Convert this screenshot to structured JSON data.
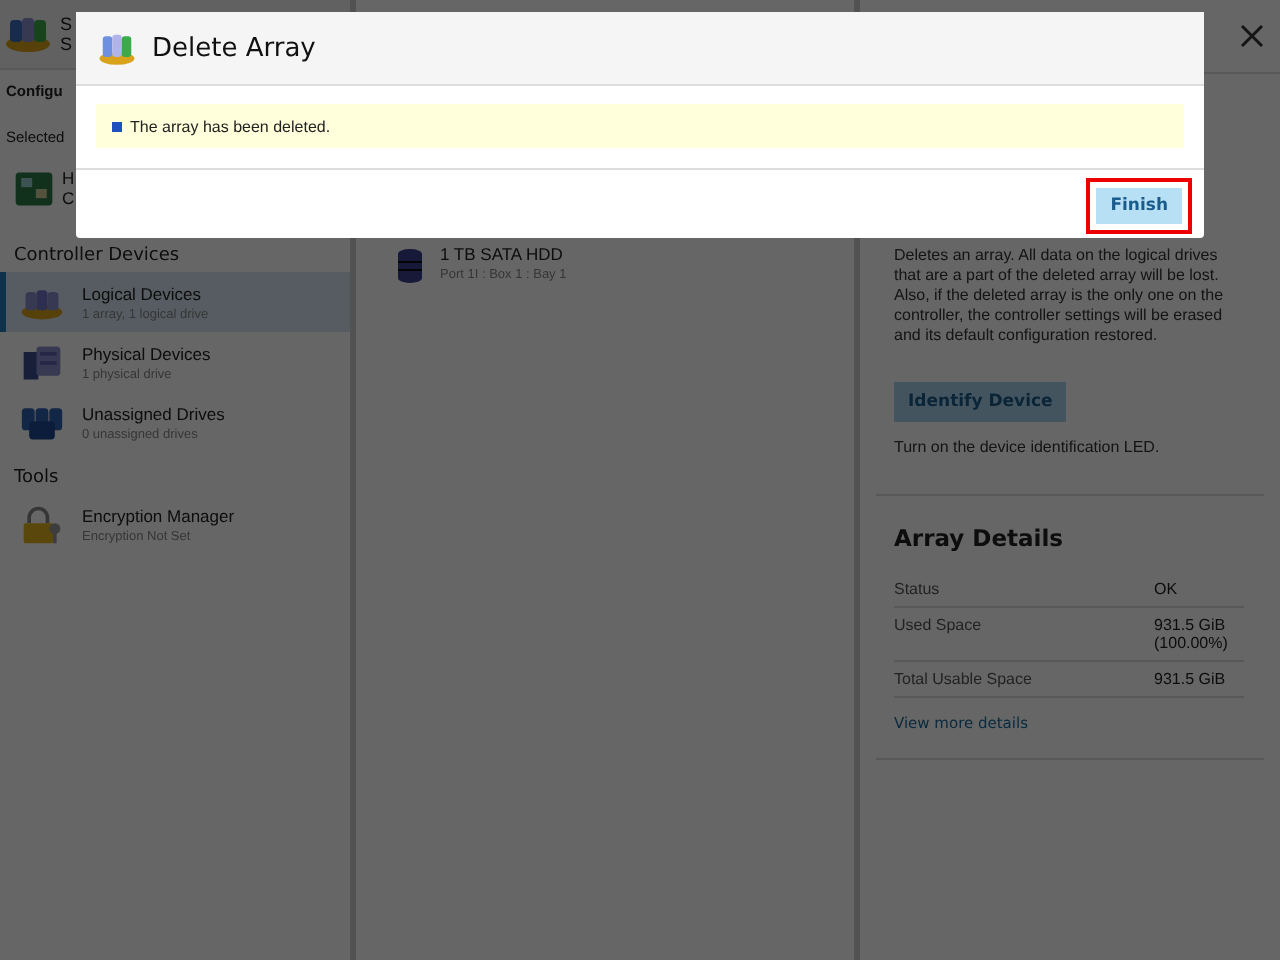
{
  "sidebar": {
    "header_lines": [
      "S",
      "S"
    ],
    "section_title": "Configu",
    "selected_label": "Selected",
    "selected_item_lines": [
      "H",
      "C"
    ],
    "groups": [
      {
        "title": "Controller Devices",
        "items": [
          {
            "kind": "logical",
            "name": "Logical Devices",
            "detail": "1 array, 1 logical drive",
            "selected": true
          },
          {
            "kind": "physical",
            "name": "Physical Devices",
            "detail": "1 physical drive",
            "selected": false
          },
          {
            "kind": "unassigned",
            "name": "Unassigned Drives",
            "detail": "0 unassigned drives",
            "selected": false
          }
        ]
      },
      {
        "title": "Tools",
        "items": [
          {
            "kind": "encryption",
            "name": "Encryption Manager",
            "detail": "Encryption Not Set",
            "selected": false
          }
        ]
      }
    ]
  },
  "drives": [
    {
      "name": "1 TB SATA HDD",
      "location": "Port 1I : Box 1 : Bay 1"
    }
  ],
  "actions": {
    "description": "Deletes an array. All data on the logical drives that are a part of the deleted array will be lost. Also, if the deleted array is the only one on the controller, the controller settings will be erased and its default configuration restored.",
    "button": "Identify Device",
    "button_note": "Turn on the device identification LED."
  },
  "array_details": {
    "title": "Array Details",
    "rows": [
      {
        "label": "Status",
        "value": "OK"
      },
      {
        "label": "Used Space",
        "value": "931.5 GiB (100.00%)"
      },
      {
        "label": "Total Usable Space",
        "value": "931.5 GiB"
      }
    ],
    "link": "View more details"
  },
  "dialog": {
    "title": "Delete Array",
    "message": "The array has been deleted.",
    "button": "Finish",
    "button_highlighted": true
  }
}
